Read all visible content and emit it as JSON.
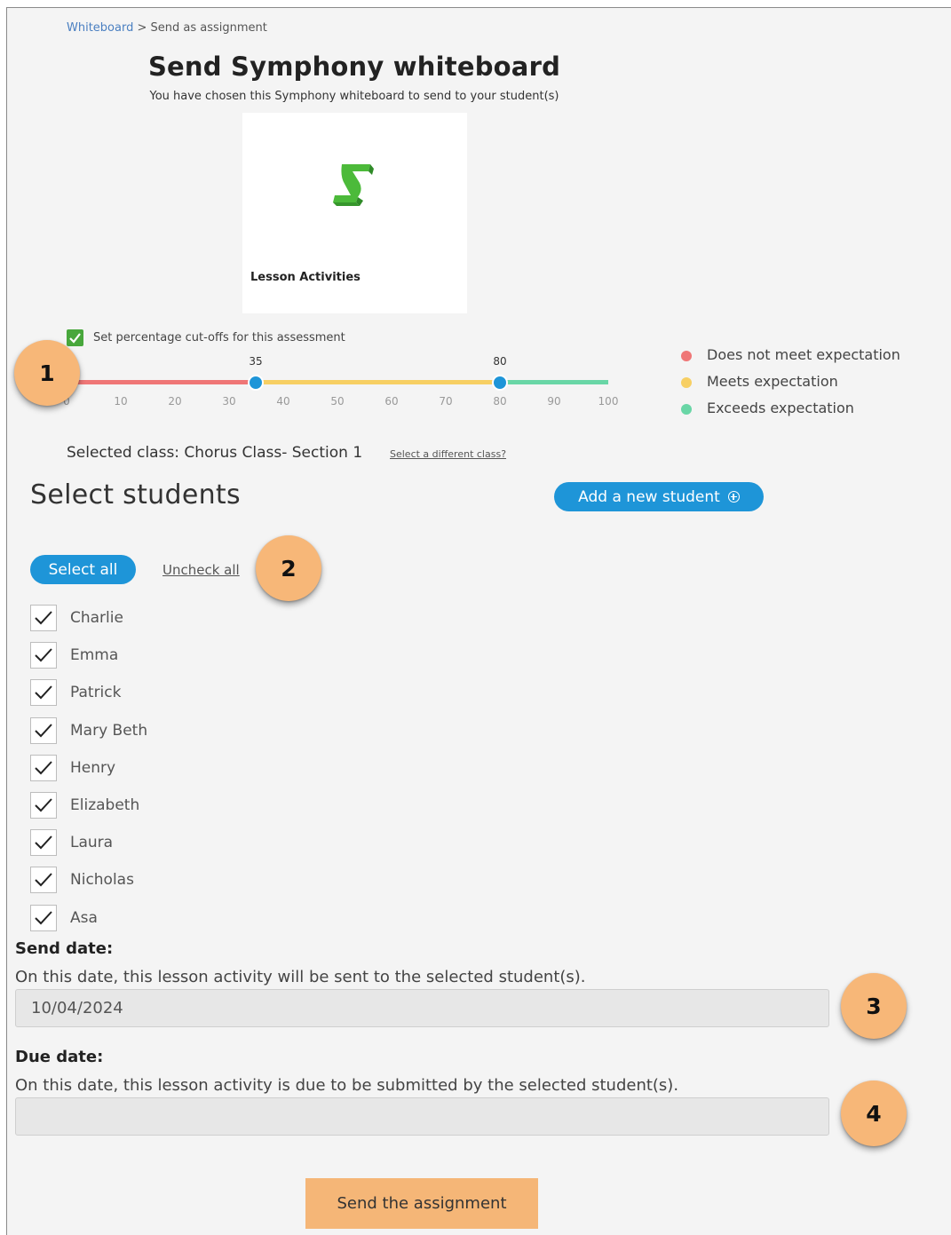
{
  "breadcrumb": {
    "parent": "Whiteboard",
    "separator": " > ",
    "current": "Send as assignment"
  },
  "header": {
    "title": "Send Symphony whiteboard",
    "subtitle": "You have chosen this Symphony whiteboard to send to your student(s)"
  },
  "card": {
    "label": "Lesson Activities",
    "logo_icon": "symphony-s-logo",
    "logo_color": "#3fae3a"
  },
  "cutoffs": {
    "checkbox_checked": true,
    "label": "Set percentage cut-offs for this assessment",
    "low_value": "35",
    "high_value": "80",
    "low_fraction": 0.35,
    "high_fraction": 0.8,
    "ticks": [
      "0",
      "10",
      "20",
      "30",
      "40",
      "50",
      "60",
      "70",
      "80",
      "90",
      "100"
    ],
    "colors": {
      "below": "#ef7676",
      "meets": "#f7cf63",
      "exceeds": "#69d6a6",
      "handle": "#1e95d8"
    }
  },
  "legend": [
    {
      "label": "Does not meet expectation",
      "color": "#ef7676"
    },
    {
      "label": "Meets expectation",
      "color": "#f7cf63"
    },
    {
      "label": "Exceeds expectation",
      "color": "#69d6a6"
    }
  ],
  "callouts": [
    "1",
    "2",
    "3",
    "4"
  ],
  "class_selection": {
    "text": "Selected class: Chorus Class- Section 1",
    "change_link": "Select a different class?"
  },
  "students_section": {
    "title": "Select students",
    "add_button": "Add a new student",
    "add_icon": "plus-circle-icon",
    "select_all": "Select all",
    "uncheck_all": "Uncheck all",
    "students": [
      {
        "name": "Charlie",
        "checked": true
      },
      {
        "name": "Emma",
        "checked": true
      },
      {
        "name": "Patrick",
        "checked": true
      },
      {
        "name": "Mary Beth",
        "checked": true
      },
      {
        "name": "Henry",
        "checked": true
      },
      {
        "name": "Elizabeth",
        "checked": true
      },
      {
        "name": "Laura",
        "checked": true
      },
      {
        "name": "Nicholas",
        "checked": true
      },
      {
        "name": "Asa",
        "checked": true
      }
    ]
  },
  "send_date": {
    "heading": "Send date:",
    "description": "On this date, this lesson activity will be sent to the selected student(s).",
    "value": "10/04/2024"
  },
  "due_date": {
    "heading": "Due date:",
    "description": "On this date, this lesson activity is due to be submitted by the selected student(s).",
    "value": ""
  },
  "submit": {
    "label": "Send the assignment",
    "color": "#f5b677"
  },
  "accent_color": "#1e95d8"
}
